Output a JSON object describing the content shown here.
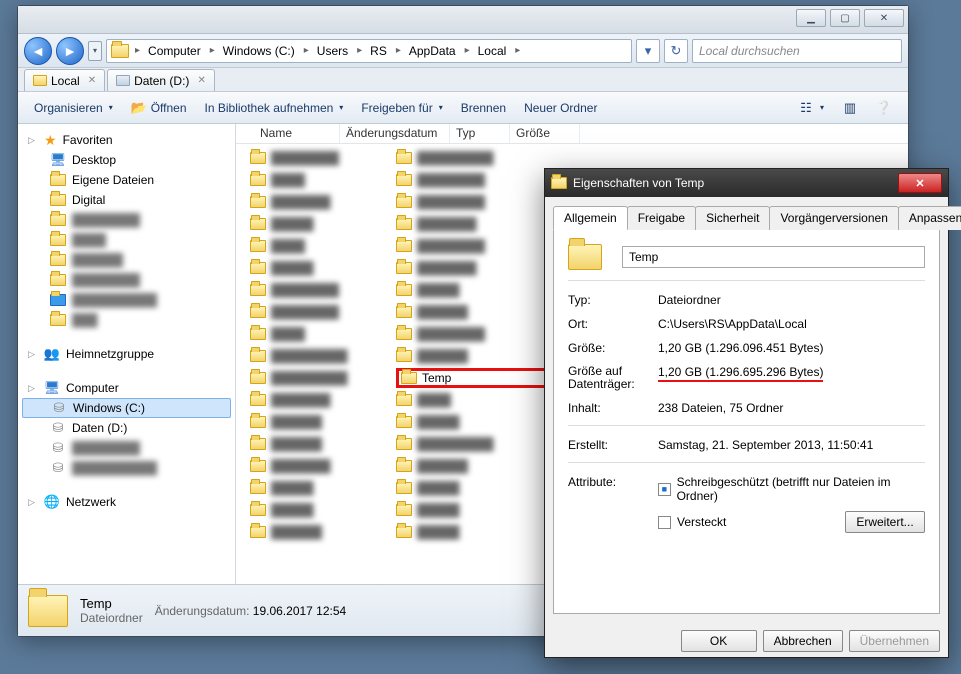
{
  "window": {
    "min": "▁",
    "max": "▢",
    "close": "✕"
  },
  "breadcrumbs": [
    "Computer",
    "Windows (C:)",
    "Users",
    "RS",
    "AppData",
    "Local"
  ],
  "search_placeholder": "Local durchsuchen",
  "tabs": [
    {
      "label": "Local",
      "icon": "folder"
    },
    {
      "label": "Daten (D:)",
      "icon": "drive"
    }
  ],
  "toolbar": {
    "organize": "Organisieren",
    "open": "Öffnen",
    "library": "In Bibliothek aufnehmen",
    "share": "Freigeben für",
    "burn": "Brennen",
    "newfolder": "Neuer Ordner"
  },
  "columns": {
    "name": "Name",
    "date": "Änderungsdatum",
    "type": "Typ",
    "size": "Größe"
  },
  "sidebar": {
    "favorites": "Favoriten",
    "desktop": "Desktop",
    "owndocs": "Eigene Dateien",
    "digital": "Digital",
    "homegroup": "Heimnetzgruppe",
    "computer": "Computer",
    "cdrive": "Windows (C:)",
    "ddrive": "Daten (D:)",
    "network": "Netzwerk"
  },
  "temp_label": "Temp",
  "detail": {
    "name": "Temp",
    "type": "Dateiordner",
    "date_key": "Änderungsdatum:",
    "date_val": "19.06.2017 12:54"
  },
  "dialog": {
    "title": "Eigenschaften von Temp",
    "tabs": [
      "Allgemein",
      "Freigabe",
      "Sicherheit",
      "Vorgängerversionen",
      "Anpassen"
    ],
    "name": "Temp",
    "type_k": "Typ:",
    "type_v": "Dateiordner",
    "loc_k": "Ort:",
    "loc_v": "C:\\Users\\RS\\AppData\\Local",
    "size_k": "Größe:",
    "size_v": "1,20 GB (1.296.096.451 Bytes)",
    "disk_k": "Größe auf Datenträger:",
    "disk_v": "1,20 GB (1.296.695.296 Bytes)",
    "cont_k": "Inhalt:",
    "cont_v": "238 Dateien, 75 Ordner",
    "created_k": "Erstellt:",
    "created_v": "Samstag, 21. September 2013, 11:50:41",
    "attr_k": "Attribute:",
    "attr_ro": "Schreibgeschützt (betrifft nur Dateien im Ordner)",
    "attr_hidden": "Versteckt",
    "advanced": "Erweitert...",
    "ok": "OK",
    "cancel": "Abbrechen",
    "apply": "Übernehmen"
  }
}
